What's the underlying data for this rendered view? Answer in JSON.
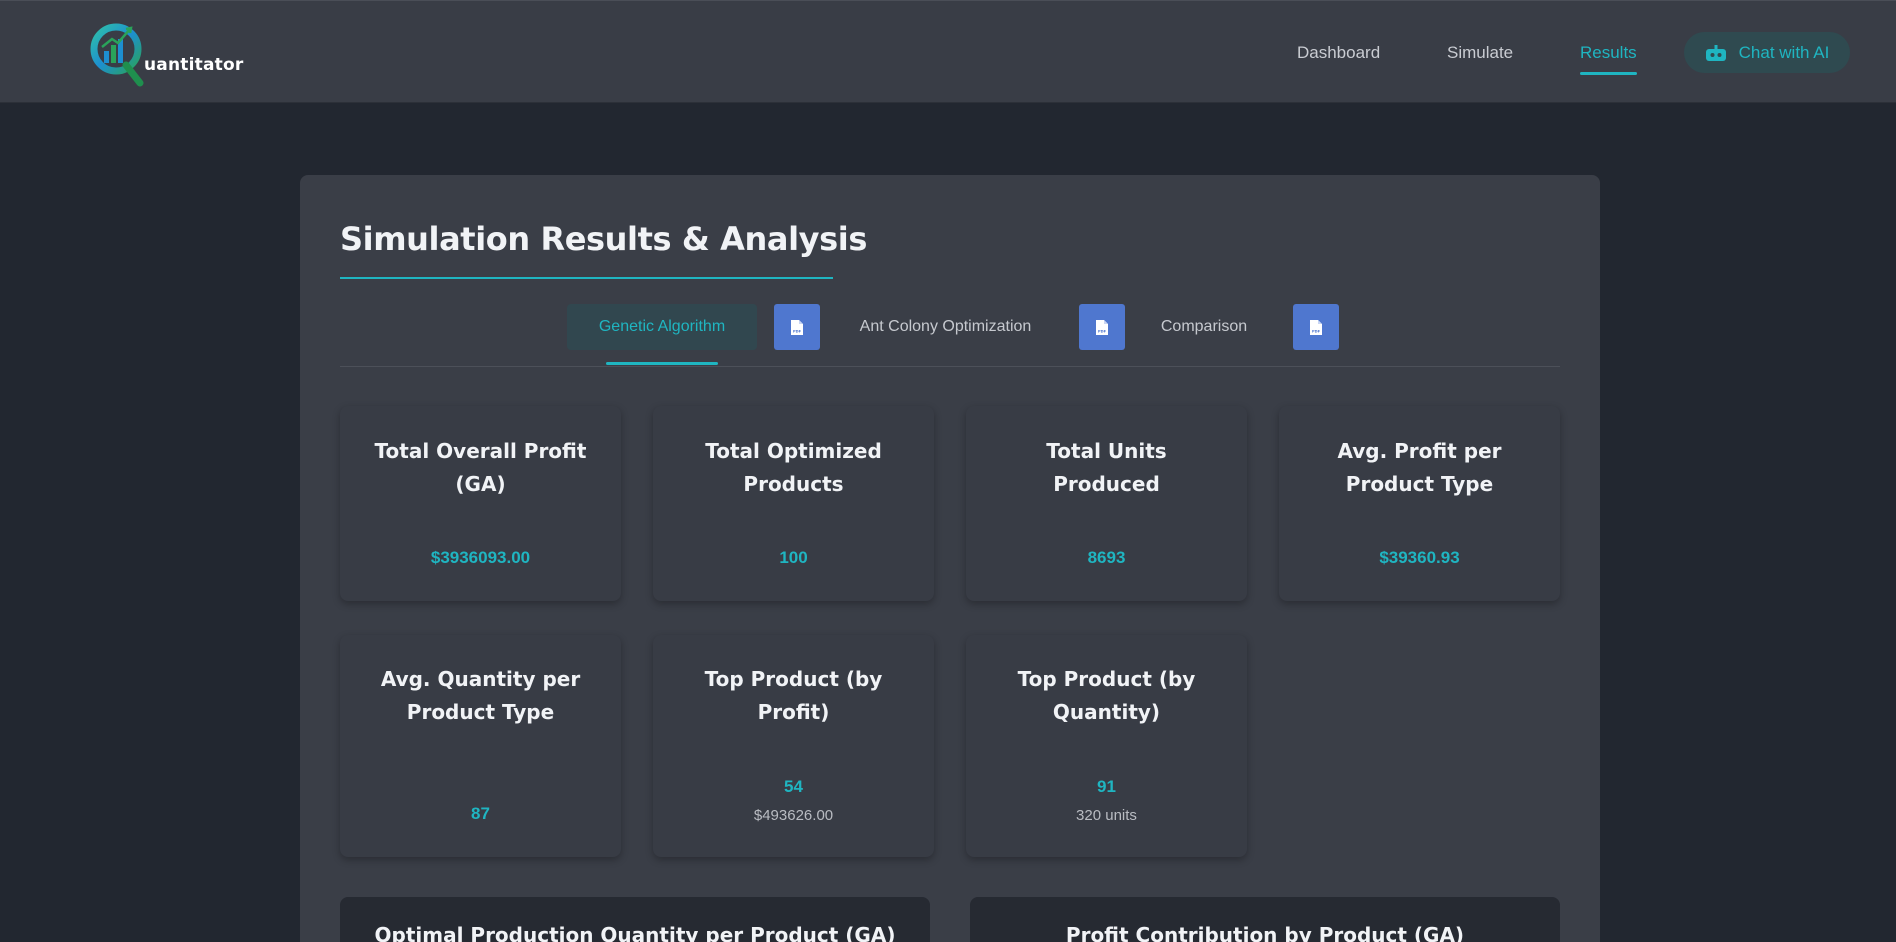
{
  "brand": {
    "name": "uantitator"
  },
  "nav": {
    "links": [
      {
        "label": "Dashboard"
      },
      {
        "label": "Simulate"
      },
      {
        "label": "Results"
      }
    ],
    "chat_label": "Chat with AI"
  },
  "page": {
    "title": "Simulation Results & Analysis"
  },
  "tabs": [
    {
      "label": "Genetic Algorithm",
      "active": true
    },
    {
      "label": "Ant Colony Optimization",
      "active": false
    },
    {
      "label": "Comparison",
      "active": false
    }
  ],
  "pdf_icon_label": "PDF",
  "stats": [
    {
      "title": "Total Overall Profit (GA)",
      "value": "$3936093.00"
    },
    {
      "title": "Total Optimized Products",
      "value": "100"
    },
    {
      "title": "Total Units Produced",
      "value": "8693"
    },
    {
      "title": "Avg. Profit per Product Type",
      "value": "$39360.93"
    },
    {
      "title": "Avg. Quantity per Product Type",
      "value": "87"
    },
    {
      "title": "Top Product (by Profit)",
      "value": "54",
      "sub": "$493626.00"
    },
    {
      "title": "Top Product (by Quantity)",
      "value": "91",
      "sub": "320 units"
    }
  ],
  "charts": [
    {
      "title": "Optimal Production Quantity per Product (GA)"
    },
    {
      "title": "Profit Contribution by Product (GA)"
    }
  ],
  "colors": {
    "accent": "#1fb5c1",
    "pdf_button": "#4f77cf",
    "background": "#222730",
    "panel": "#3a3e47",
    "navbar": "#393d46"
  }
}
